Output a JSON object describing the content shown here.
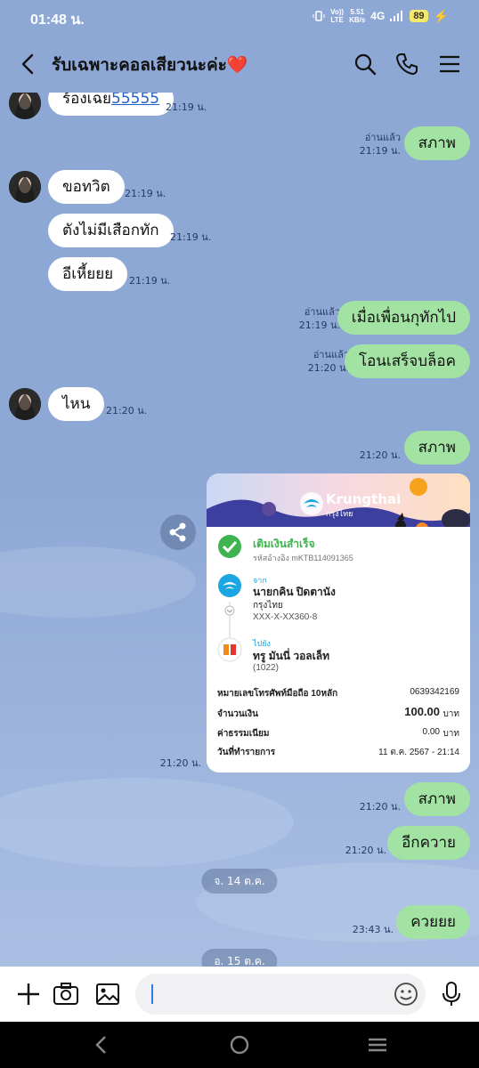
{
  "status": {
    "time": "01:48 น.",
    "volte_top": "Vo))",
    "volte_bottom": "LTE",
    "speed_top": "5.51",
    "speed_bottom": "KB/s",
    "network": "4G",
    "battery": "89"
  },
  "header": {
    "title": "รับเฉพาะคอลเสียวนะค่ะ❤️"
  },
  "messages": {
    "m0_text": "ร้องเฉย",
    "m0_link": "55555",
    "m0_time": "21:19 น.",
    "m1_read": "อ่านแล้ว",
    "m1_time": "21:19 น.",
    "m1_text": "สภาพ",
    "m2_text": "ขอทวิต",
    "m2_time": "21:19 น.",
    "m3_text": "ตังไม่มีเสือกทัก",
    "m3_time": "21:19 น.",
    "m4_text": "อีเหี้ยยย",
    "m4_time": "21:19 น.",
    "m5_read": "อ่านแล้ว",
    "m5_time": "21:19 น.",
    "m5_text": "เมื่อเพื่อนกุทักไป",
    "m6_read": "อ่านแล้ว",
    "m6_time": "21:20 น.",
    "m6_text": "โอนเสร็จบล็อค",
    "m7_text": "ไหน",
    "m7_time": "21:20 น.",
    "m8_time": "21:20 น.",
    "m8_text": "สภาพ",
    "m9_time": "21:20 น.",
    "m10_time": "21:20 น.",
    "m10_text": "สภาพ",
    "m11_time": "21:20 น.",
    "m11_text": "อีกควาย",
    "date1": "จ. 14 ต.ค.",
    "m12_time": "23:43 น.",
    "m12_text": "ควยยย",
    "date2": "อ. 15 ต.ค."
  },
  "receipt": {
    "bank_name": "Krungthai",
    "bank_name_th": "กรุงไทย",
    "status": "เติมเงินสำเร็จ",
    "ref": "รหัสอ้างอิง mKTB114091365",
    "from_label": "จาก",
    "from_name": "นายกคิน ปิดตานัง",
    "from_bank": "กรุงไทย",
    "from_acct": "XXX-X-XX360-8",
    "to_label": "ไปยัง",
    "to_name": "ทรู มันนี่ วอลเล็ท",
    "to_code": "(1022)",
    "phone_label": "หมายเลขโทรศัพท์มือถือ 10หลัก",
    "phone_value": "0639342169",
    "amount_label": "จำนวนเงิน",
    "amount_value": "100.00",
    "amount_unit": "บาท",
    "fee_label": "ค่าธรรมเนียม",
    "fee_value": "0.00",
    "fee_unit": "บาท",
    "date_label": "วันที่ทำรายการ",
    "date_value": "11 ต.ค. 2567 - 21:14"
  },
  "colors": {
    "background": "#8ea8d6",
    "out_bubble": "#a2e2a2",
    "in_bubble": "#ffffff"
  }
}
